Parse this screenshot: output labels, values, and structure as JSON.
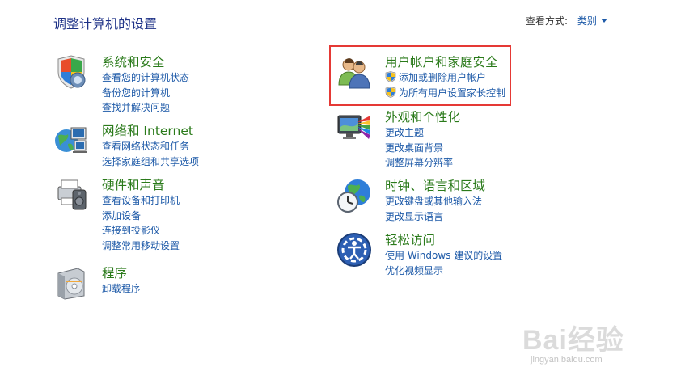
{
  "header": {
    "title": "调整计算机的设置",
    "view_by_label": "查看方式:",
    "view_by_value": "类别"
  },
  "categories": {
    "system": {
      "title": "系统和安全",
      "links": [
        "查看您的计算机状态",
        "备份您的计算机",
        "查找并解决问题"
      ]
    },
    "network": {
      "title": "网络和 Internet",
      "links": [
        "查看网络状态和任务",
        "选择家庭组和共享选项"
      ]
    },
    "hardware": {
      "title": "硬件和声音",
      "links": [
        "查看设备和打印机",
        "添加设备",
        "连接到投影仪",
        "调整常用移动设置"
      ]
    },
    "programs": {
      "title": "程序",
      "links": [
        "卸载程序"
      ]
    },
    "user": {
      "title": "用户帐户和家庭安全",
      "links": [
        "添加或删除用户帐户",
        "为所有用户设置家长控制"
      ]
    },
    "appearance": {
      "title": "外观和个性化",
      "links": [
        "更改主题",
        "更改桌面背景",
        "调整屏幕分辨率"
      ]
    },
    "clock": {
      "title": "时钟、语言和区域",
      "links": [
        "更改键盘或其他输入法",
        "更改显示语言"
      ]
    },
    "ease": {
      "title": "轻松访问",
      "links": [
        "使用 Windows 建议的设置",
        "优化视频显示"
      ]
    }
  },
  "watermark": {
    "main": "Bai经验",
    "sub": "jingyan.baidu.com"
  },
  "colors": {
    "title": "#1e3287",
    "category": "#2a7a1a",
    "link": "#1e5aa8",
    "highlight": "#e53935"
  }
}
